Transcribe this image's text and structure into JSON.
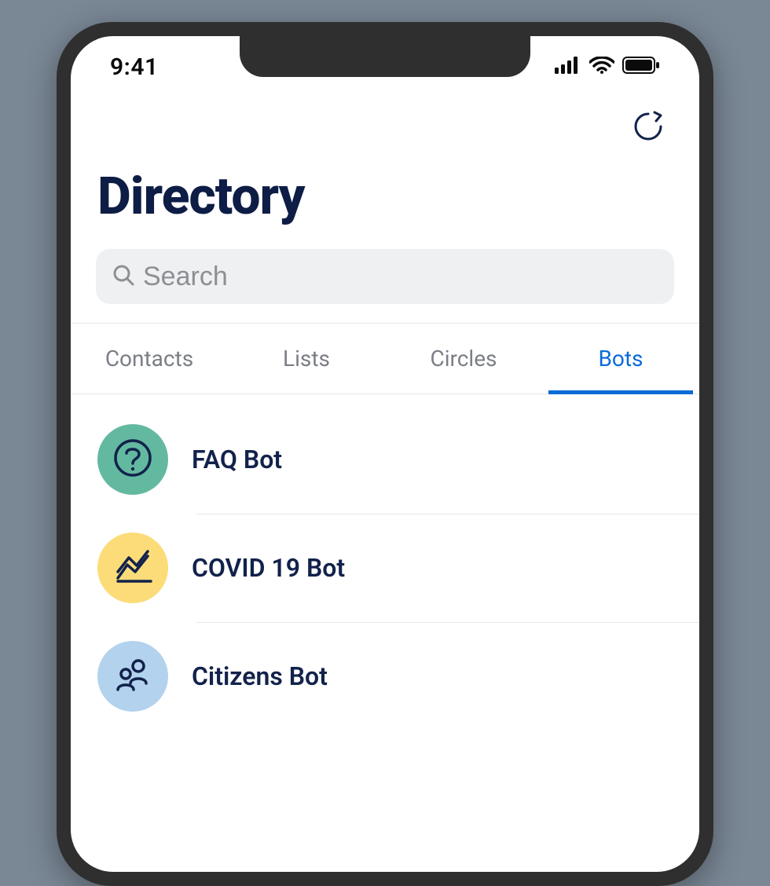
{
  "statusbar": {
    "time": "9:41"
  },
  "page": {
    "title": "Directory"
  },
  "search": {
    "placeholder": "Search"
  },
  "tabs": [
    {
      "label": "Contacts",
      "active": false
    },
    {
      "label": "Lists",
      "active": false
    },
    {
      "label": "Circles",
      "active": false
    },
    {
      "label": "Bots",
      "active": true
    }
  ],
  "bots": [
    {
      "name": "FAQ Bot",
      "icon": "question",
      "bg": "#63b9a0"
    },
    {
      "name": "COVID 19 Bot",
      "icon": "chart",
      "bg": "#fbdc78"
    },
    {
      "name": "Citizens Bot",
      "icon": "people",
      "bg": "#b3d2ed"
    }
  ],
  "colors": {
    "accent": "#0a6bd8",
    "heading": "#0d1d45",
    "iconStroke": "#12224b"
  }
}
